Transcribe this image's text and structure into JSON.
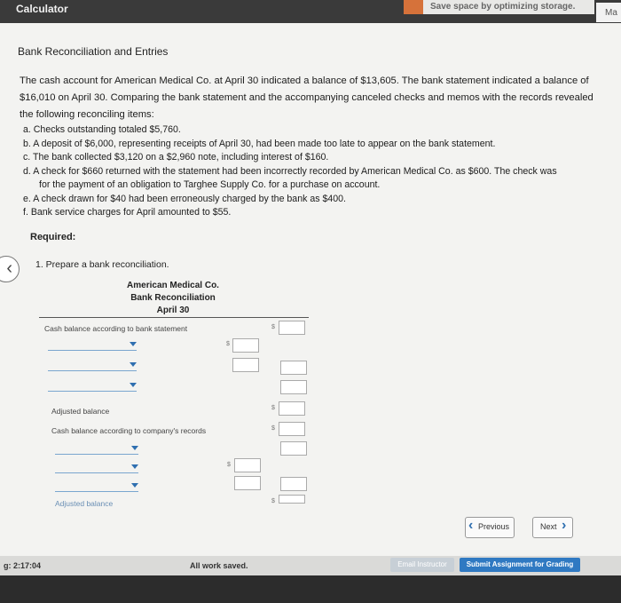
{
  "topbar": {
    "calculator_label": "Calculator",
    "banner_text": "Save space by optimizing storage.",
    "side_tab": "Ma"
  },
  "problem": {
    "title": "Bank Reconciliation and Entries",
    "paragraph_lines": [
      "The cash account for American Medical Co. at April 30 indicated a balance of $13,605. The bank statement indicated a balance of",
      "$16,010 on April 30. Comparing the bank statement and the accompanying canceled checks and memos with the records revealed",
      "the following reconciling items:"
    ],
    "items": [
      "a.  Checks outstanding totaled $5,760.",
      "b.  A deposit of $6,000, representing receipts of April 30, had been made too late to appear on the bank statement.",
      "c.  The bank collected $3,120 on a $2,960 note, including interest of $160.",
      "d.  A check for $660 returned with the statement had been incorrectly recorded by American Medical Co. as $600. The check was",
      "for the payment of an obligation to Targhee Supply Co. for a purchase on account.",
      "e.  A check drawn for $40 had been erroneously charged by the bank as $400.",
      "f.  Bank service charges for April amounted to $55."
    ],
    "required_label": "Required:",
    "question": "1.  Prepare a bank reconciliation."
  },
  "recon": {
    "company": "American Medical Co.",
    "statement": "Bank Reconciliation",
    "date": "April 30",
    "bank_balance_label": "Cash balance according to bank statement",
    "adjusted_balance_label_1": "Adjusted balance",
    "company_balance_label": "Cash balance according to company's records",
    "adjusted_balance_label_2": "Adjusted balance",
    "currency_symbol": "$"
  },
  "nav": {
    "previous_label": "Previous",
    "next_label": "Next"
  },
  "footer": {
    "timer": "g: 2:17:04",
    "status": "All work saved.",
    "email_label": "Email Instructor",
    "submit_label": "Submit Assignment for Grading"
  },
  "colors": {
    "accent": "#2f79c2",
    "dropdown_arrow": "#2f6fb0"
  }
}
